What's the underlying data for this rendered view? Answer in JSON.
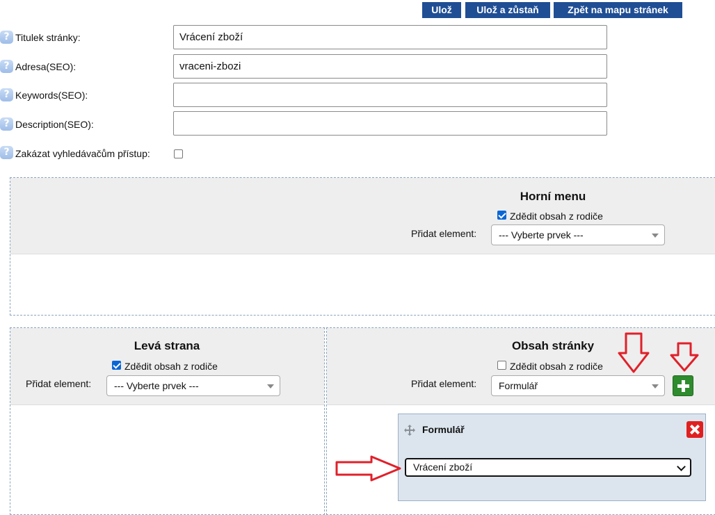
{
  "toolbar": {
    "save_label": "Ulož",
    "save_stay_label": "Ulož a zůstaň",
    "back_label": "Zpět na mapu stránek"
  },
  "form": {
    "help_glyph": "?",
    "title_label": "Titulek stránky:",
    "title_value": "Vrácení zboží",
    "address_label": "Adresa(SEO):",
    "address_value": "vraceni-zbozi",
    "keywords_label": "Keywords(SEO):",
    "keywords_value": "",
    "description_label": "Description(SEO):",
    "description_value": "",
    "noindex_label": "Zakázat vyhledávačům přístup:",
    "noindex_checked": false
  },
  "panels": {
    "top_menu": {
      "title": "Horní menu",
      "inherit_label": "Zdědit obsah z rodiče",
      "inherit_checked": true,
      "add_label": "Přidat element:",
      "select_value": "--- Vyberte prvek ---"
    },
    "left_side": {
      "title": "Levá strana",
      "inherit_label": "Zdědit obsah z rodiče",
      "inherit_checked": true,
      "add_label": "Přidat element:",
      "select_value": "--- Vyberte prvek ---"
    },
    "page_content": {
      "title": "Obsah stránky",
      "inherit_label": "Zdědit obsah z rodiče",
      "inherit_checked": false,
      "add_label": "Přidat element:",
      "select_value": "Formulář",
      "element": {
        "title": "Formulář",
        "selected_form": "Vrácení zboží"
      }
    }
  },
  "colors": {
    "button_bg": "#1f4e94",
    "panel_header_bg": "#eeeeee",
    "add_button": "#2e8b2e",
    "delete_button": "#e02020",
    "annotation_arrow": "#e0202a"
  },
  "icons": {
    "help": "help-icon",
    "move": "move-icon",
    "add": "plus-icon",
    "delete": "close-icon"
  }
}
